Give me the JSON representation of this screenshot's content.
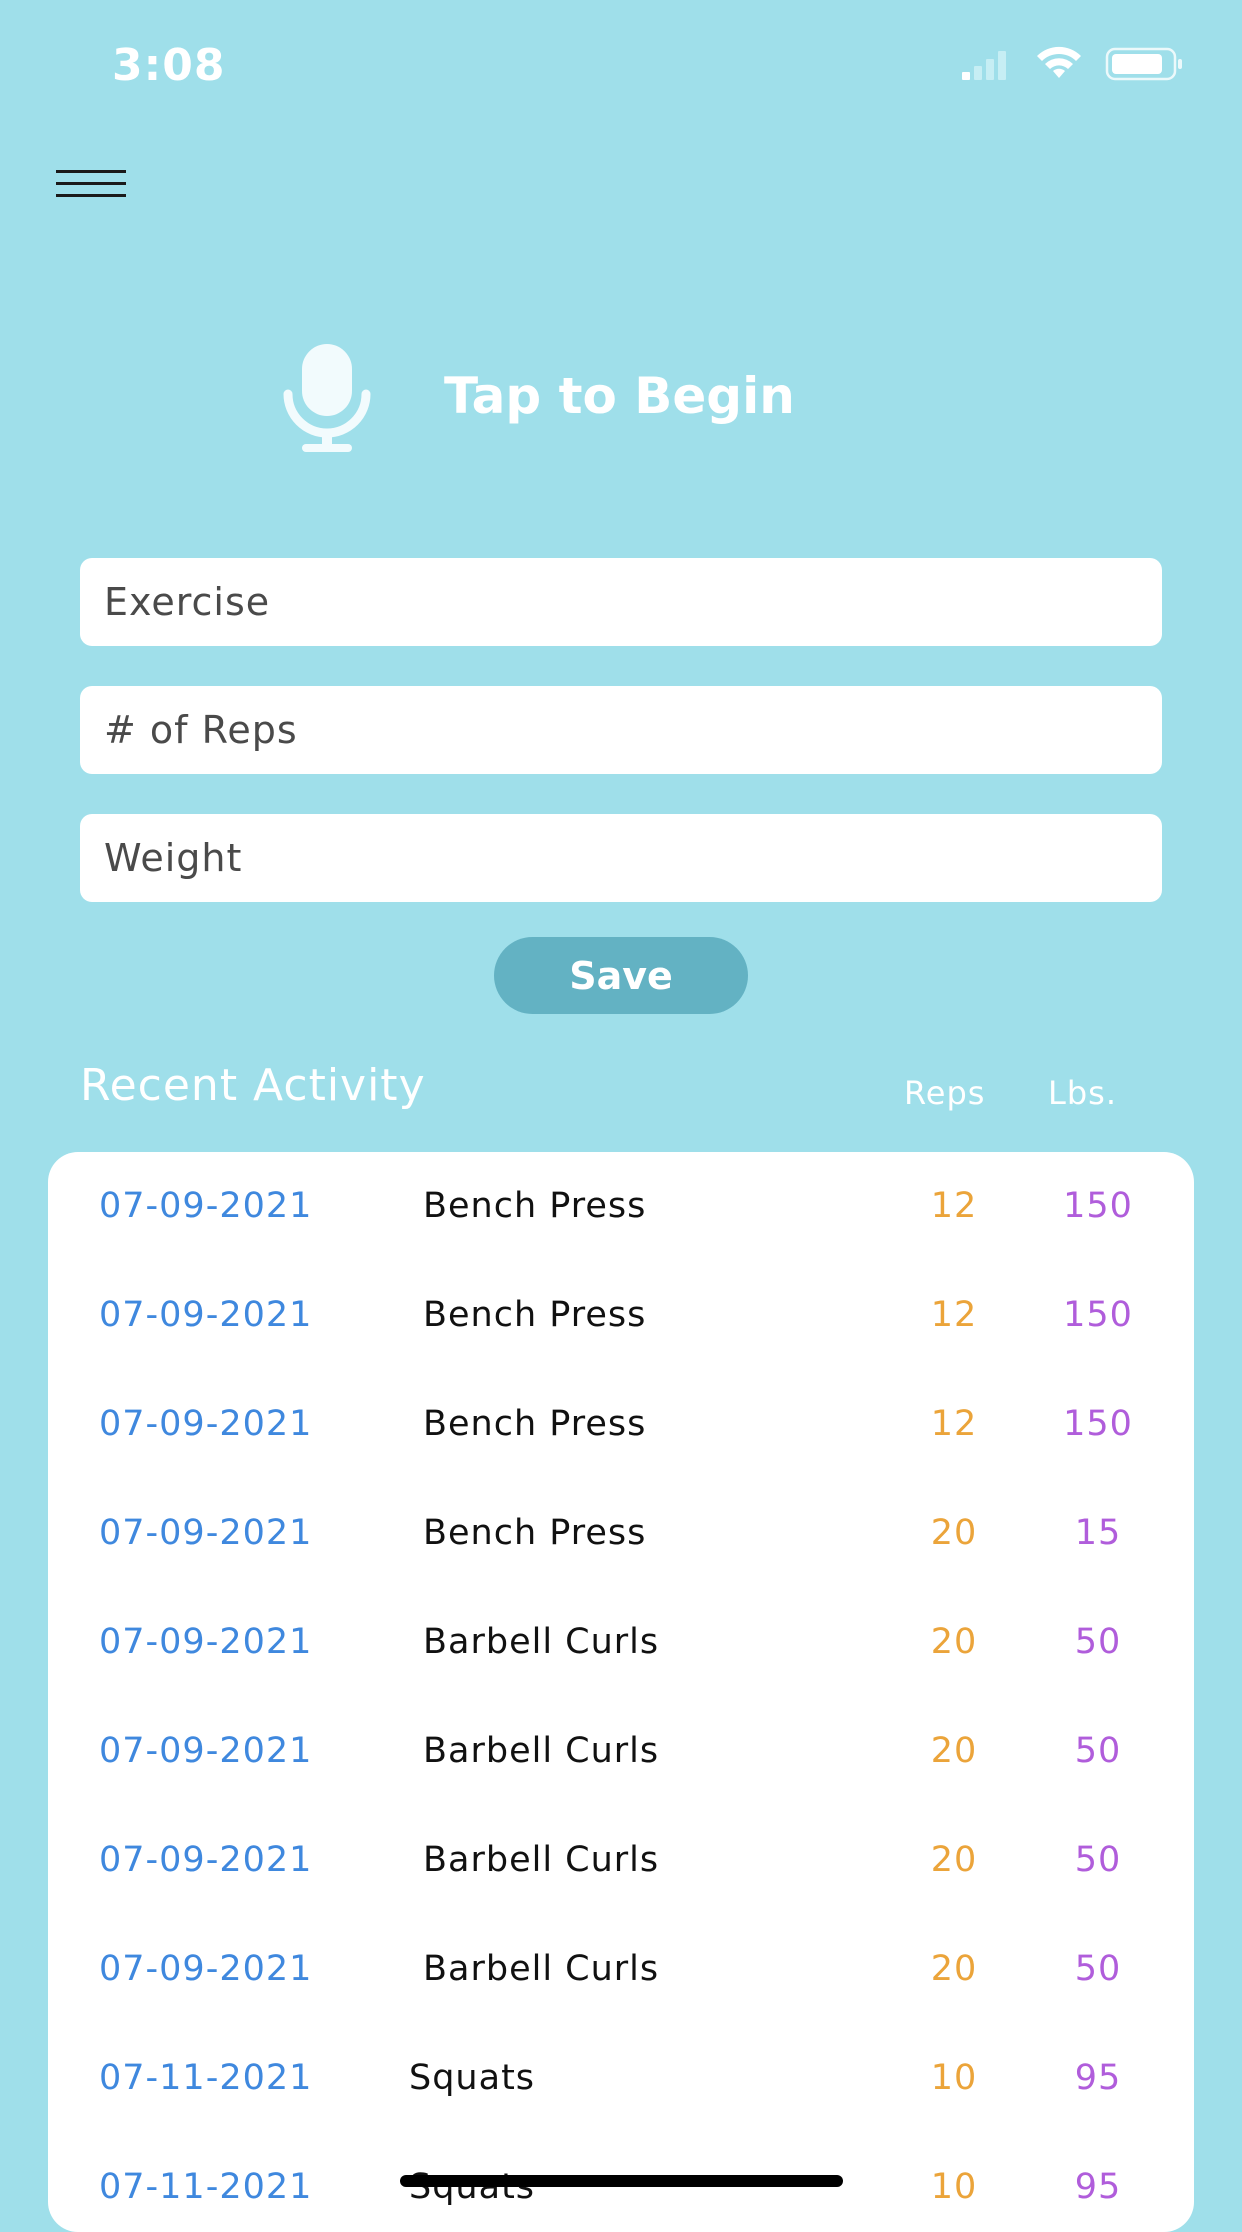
{
  "status": {
    "time": "3:08"
  },
  "hero": {
    "label": "Tap to Begin"
  },
  "form": {
    "exercise_placeholder": "Exercise",
    "reps_placeholder": "# of Reps",
    "weight_placeholder": "Weight",
    "save_label": "Save"
  },
  "activity": {
    "title": "Recent Activity",
    "col_reps": "Reps",
    "col_lbs": "Lbs.",
    "rows": [
      {
        "date": "07-09-2021",
        "exercise": "Bench Press",
        "reps": "12",
        "lbs": "150"
      },
      {
        "date": "07-09-2021",
        "exercise": "Bench Press",
        "reps": "12",
        "lbs": "150"
      },
      {
        "date": "07-09-2021",
        "exercise": "Bench Press",
        "reps": "12",
        "lbs": "150"
      },
      {
        "date": "07-09-2021",
        "exercise": "Bench Press",
        "reps": "20",
        "lbs": "15"
      },
      {
        "date": "07-09-2021",
        "exercise": "Barbell Curls",
        "reps": "20",
        "lbs": "50"
      },
      {
        "date": "07-09-2021",
        "exercise": "Barbell Curls",
        "reps": "20",
        "lbs": "50"
      },
      {
        "date": "07-09-2021",
        "exercise": "Barbell Curls",
        "reps": "20",
        "lbs": "50"
      },
      {
        "date": "07-09-2021",
        "exercise": "Barbell Curls",
        "reps": "20",
        "lbs": "50"
      },
      {
        "date": "07-11-2021",
        "exercise": "Squats",
        "reps": "10",
        "lbs": "95"
      },
      {
        "date": "07-11-2021",
        "exercise": "Squats",
        "reps": "10",
        "lbs": "95"
      }
    ]
  },
  "colors": {
    "background": "#9fdfea",
    "date": "#3f88de",
    "reps": "#eba43a",
    "lbs": "#b05ddb",
    "save_button": "#63b2c3"
  },
  "icons": {
    "menu": "hamburger-menu-icon",
    "mic": "microphone-icon",
    "signal": "cellular-signal-icon",
    "wifi": "wifi-icon",
    "battery": "battery-icon"
  }
}
